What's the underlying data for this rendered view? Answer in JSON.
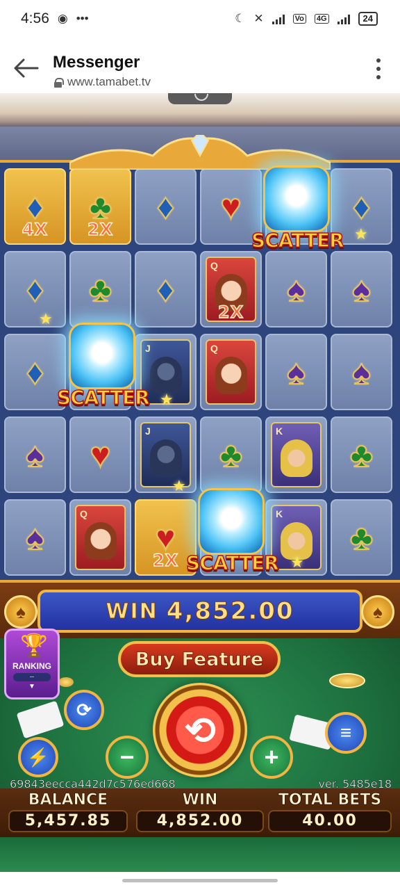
{
  "status_bar": {
    "time": "4:56",
    "battery": "24",
    "network": "4G"
  },
  "browser": {
    "title": "Messenger",
    "url": "www.tamabet.tv"
  },
  "grid": [
    [
      {
        "type": "diamond",
        "gold": true,
        "mult": "4X"
      },
      {
        "type": "club",
        "gold": true,
        "mult": "2X"
      },
      {
        "type": "diamond"
      },
      {
        "type": "heart"
      },
      {
        "type": "blank"
      },
      {
        "type": "diamond"
      }
    ],
    [
      {
        "type": "diamond"
      },
      {
        "type": "club"
      },
      {
        "type": "diamond"
      },
      {
        "type": "queen",
        "mult": "2X"
      },
      {
        "type": "spade"
      },
      {
        "type": "spade"
      }
    ],
    [
      {
        "type": "diamond"
      },
      {
        "type": "blank"
      },
      {
        "type": "jack"
      },
      {
        "type": "queen"
      },
      {
        "type": "spade"
      },
      {
        "type": "spade"
      }
    ],
    [
      {
        "type": "spade"
      },
      {
        "type": "heart"
      },
      {
        "type": "jack"
      },
      {
        "type": "club"
      },
      {
        "type": "king"
      },
      {
        "type": "club"
      }
    ],
    [
      {
        "type": "spade"
      },
      {
        "type": "queen"
      },
      {
        "type": "heart",
        "gold": true,
        "mult": "2X"
      },
      {
        "type": "blank"
      },
      {
        "type": "king"
      },
      {
        "type": "club"
      }
    ]
  ],
  "scatter_label": "SCATTER",
  "win_bar": {
    "label": "WIN",
    "amount": "4,852.00"
  },
  "buy_feature": "Buy Feature",
  "ranking": {
    "label": "RANKING",
    "value": "--"
  },
  "info": {
    "hash": "69843eecca442d7c576ed668",
    "version": "ver. 5485e18",
    "balance_label": "BALANCE",
    "balance": "5,457.85",
    "win_label": "WIN",
    "win": "4,852.00",
    "total_bets_label": "TOTAL BETS",
    "total_bets": "40.00"
  },
  "colors": {
    "gold": "#f0b641",
    "win_blue": "#2231a0",
    "table_green": "#1d6f3e",
    "scatter_text": "#ffcf3c"
  }
}
